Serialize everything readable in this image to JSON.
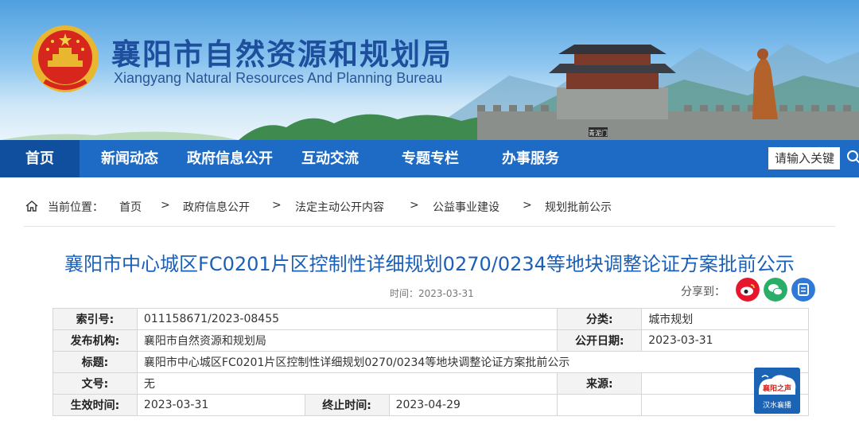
{
  "header": {
    "title": "襄阳市自然资源和规划局",
    "subtitle": "Xiangyang Natural Resources And Planning Bureau",
    "gate_plaque": "青泥门"
  },
  "nav": {
    "items": [
      {
        "label": "首页",
        "active": true
      },
      {
        "label": "新闻动态"
      },
      {
        "label": "政府信息公开"
      },
      {
        "label": "互动交流"
      },
      {
        "label": "专题专栏"
      },
      {
        "label": "办事服务"
      }
    ],
    "search_placeholder": "请输入关键"
  },
  "breadcrumb": {
    "prefix": "当前位置：",
    "separator": ">",
    "items": [
      "首页",
      "政府信息公开",
      "法定主动公开内容",
      "公益事业建设",
      "规划批前公示"
    ]
  },
  "article": {
    "title": "襄阳市中心城区FC0201片区控制性详细规划0270/0234等地块调整论证方案批前公示",
    "date": "时间：2023-03-31",
    "share_label": "分享到：",
    "share_icons": [
      "weibo-icon",
      "wechat-icon",
      "qzone-icon"
    ]
  },
  "info_table": {
    "index_label": "索引号:",
    "index_value": "011158671/2023-08455",
    "category_label": "分类:",
    "category_value": "城市规划",
    "publisher_label": "发布机构:",
    "publisher_value": "襄阳市自然资源和规划局",
    "pubdate_label": "公开日期:",
    "pubdate_value": "2023-03-31",
    "title_label": "标题:",
    "title_value": "襄阳市中心城区FC0201片区控制性详细规划0270/0234等地块调整论证方案批前公示",
    "docno_label": "文号:",
    "docno_value": "无",
    "source_label": "来源:",
    "source_value": "",
    "effective_label": "生效时间:",
    "effective_value": "2023-03-31",
    "expire_label": "终止时间:",
    "expire_value": "2023-04-29"
  },
  "badge": {
    "line1": "襄阳之声",
    "line2": "汉水襄播"
  },
  "colors": {
    "nav_bg": "#1e6bc6",
    "nav_active": "#0f4f9e",
    "title_blue": "#1a5fb8",
    "weibo": "#e6162d",
    "wechat": "#2aae67",
    "qzone": "#2f7ad6"
  }
}
